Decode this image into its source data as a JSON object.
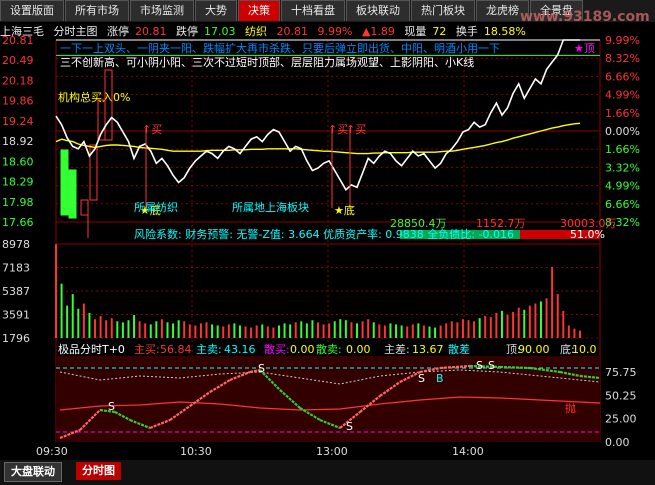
{
  "tabs": [
    "设置版面",
    "所有市场",
    "市场监测",
    "大势",
    "决策",
    "十档看盘",
    "板块联动",
    "热门板块",
    "龙虎榜",
    "全景盘"
  ],
  "active_tab": "决策",
  "watermark": "www.93189.com",
  "info": {
    "name": "上海三毛",
    "mode": "分时主图",
    "zt_label": "涨停",
    "zt": "20.81",
    "dt_label": "跌停",
    "dt": "17.03",
    "sector": "纺织",
    "price": "20.81",
    "pct": "9.99%",
    "chg": "▲1.89",
    "now_label": "现量",
    "now": "72",
    "turn_label": "换手",
    "turn": "18.58%"
  },
  "marquee": [
    "一下一上双头、一阴夹一阳、跌幅扩大再市杀跌、只要后弹立即出货、中阳、明酒小用一下",
    "三不创新高、可小阴小阳、三次不过短时顶部、层层阻力属场观望、上影阴阳、小K线"
  ],
  "labels": {
    "inst": "机构总买入0%",
    "buy1": "买",
    "buy2": "买",
    "buy3": "买",
    "sector1": "所属纺织",
    "sector2": "所属地上海板块",
    "low1": "底",
    "low2": "底",
    "top": "顶",
    "risk": "风险系数: 财务预警: 无警-Z值: 3.664 优质资产率: 0.9838 全负债比: -0.016",
    "pct_bar": "51.0%",
    "flow1": "28850.4万",
    "flow2": "1152.7万",
    "flow3": "30003.0万"
  },
  "price_axis": {
    "left": [
      "20.81",
      "20.49",
      "20.18",
      "19.86",
      "19.24",
      "18.92",
      "18.60",
      "18.29",
      "17.98",
      "17.66"
    ],
    "right": [
      "9.99%",
      "8.32%",
      "6.66%",
      "4.99%",
      "1.66%",
      "0.00%",
      "1.66%",
      "3.32%",
      "4.99%",
      "6.66%",
      "8.32%"
    ]
  },
  "volume_axis": [
    "8978",
    "7183",
    "5387",
    "3591",
    "1796"
  ],
  "indicator": {
    "name": "极品分时T+0",
    "main_buy_label": "主买:",
    "main_buy": "56.84",
    "main_sell_label": "主卖:",
    "main_sell": "43.16",
    "retail_buy_label": "散买:",
    "retail_buy": "0.00",
    "retail_sell_label": "散卖:",
    "retail_sell": "0.00",
    "diff_label": "主差:",
    "diff": "13.67",
    "extra": "散差",
    "top_label": "顶:",
    "top": "90.00",
    "bot_label": "底:",
    "bot": "10.0",
    "axis": [
      "75.75",
      "50.25",
      "25.00",
      "0.00"
    ],
    "marks": {
      "s": "S",
      "b": "B",
      "buy": "买",
      "sell": "抛"
    }
  },
  "time_axis": [
    "09:30",
    "10:30",
    "13:00",
    "14:00"
  ],
  "bottom_tabs": [
    "大盘联动",
    "分时图"
  ],
  "colors": {
    "price": "#ffffff",
    "avg": "#ffff00",
    "up": "#ff3030",
    "down": "#00ff00",
    "grid": "#8b0000",
    "cyan": "#00ffff"
  },
  "chart_data": {
    "type": "line",
    "title": "上海三毛 分时主图",
    "ylim": [
      17.03,
      20.81
    ],
    "price": [
      19.23,
      19.05,
      18.78,
      18.6,
      18.55,
      18.7,
      18.4,
      18.55,
      18.85,
      19.05,
      19.2,
      19.1,
      18.9,
      18.7,
      18.35,
      18.6,
      18.65,
      18.5,
      18.25,
      18.35,
      18.2,
      18.0,
      17.85,
      17.95,
      18.15,
      18.3,
      18.4,
      18.5,
      18.45,
      18.35,
      18.5,
      18.6,
      18.55,
      18.45,
      18.6,
      18.75,
      18.8,
      18.7,
      18.85,
      18.95,
      18.9,
      18.7,
      18.5,
      18.6,
      18.55,
      18.3,
      18.1,
      18.15,
      18.25,
      18.3,
      18.1,
      17.9,
      17.7,
      17.8,
      17.75,
      18.05,
      18.35,
      18.25,
      18.4,
      18.5,
      18.45,
      18.3,
      18.2,
      18.35,
      18.5,
      18.4,
      18.45,
      18.3,
      18.15,
      18.25,
      18.45,
      18.55,
      18.7,
      18.9,
      18.95,
      19.1,
      19.0,
      19.05,
      19.3,
      19.5,
      19.25,
      19.4,
      19.7,
      19.9,
      19.6,
      19.8,
      20.0,
      19.9,
      20.2,
      20.35,
      20.5,
      20.81,
      20.81,
      20.81,
      20.81
    ],
    "avg": [
      18.7,
      18.75,
      18.72,
      18.7,
      18.65,
      18.62,
      18.6,
      18.58,
      18.6,
      18.62,
      18.63,
      18.63,
      18.62,
      18.61,
      18.6,
      18.58,
      18.57,
      18.56,
      18.55,
      18.54,
      18.52,
      18.5,
      18.5,
      18.5,
      18.5,
      18.5,
      18.5,
      18.51,
      18.52,
      18.52,
      18.52,
      18.52,
      18.53,
      18.53,
      18.53,
      18.54,
      18.54,
      18.54,
      18.55,
      18.55,
      18.55,
      18.55,
      18.55,
      18.55,
      18.54,
      18.53,
      18.52,
      18.51,
      18.5,
      18.5,
      18.49,
      18.48,
      18.47,
      18.46,
      18.45,
      18.45,
      18.45,
      18.46,
      18.46,
      18.47,
      18.47,
      18.47,
      18.47,
      18.47,
      18.48,
      18.48,
      18.48,
      18.48,
      18.48,
      18.49,
      18.5,
      18.5,
      18.52,
      18.54,
      18.56,
      18.58,
      18.6,
      18.62,
      18.65,
      18.68,
      18.7,
      18.73,
      18.77,
      18.8,
      18.83,
      18.86,
      18.89,
      18.92,
      18.95,
      18.98,
      19.0,
      19.03,
      19.05,
      19.07,
      19.08
    ],
    "volume": [
      8978,
      5200,
      3100,
      4200,
      2800,
      3300,
      2400,
      1800,
      2100,
      1700,
      1900,
      1600,
      1500,
      1700,
      2200,
      1600,
      1400,
      1300,
      1600,
      1800,
      1500,
      1400,
      1700,
      1600,
      1300,
      1200,
      1400,
      1500,
      1300,
      1200,
      1100,
      1300,
      1400,
      1200,
      1100,
      1000,
      1200,
      1300,
      1100,
      1000,
      1200,
      1400,
      1300,
      1500,
      1600,
      1400,
      1700,
      1500,
      1300,
      1400,
      1600,
      1800,
      1700,
      1500,
      1400,
      1600,
      1800,
      1500,
      1300,
      1200,
      1400,
      1300,
      1200,
      1100,
      1300,
      1400,
      1200,
      1100,
      1000,
      1200,
      1400,
      1600,
      1500,
      1800,
      1700,
      1600,
      1900,
      2100,
      2000,
      2400,
      2600,
      2200,
      2500,
      2900,
      2700,
      3100,
      3300,
      3500,
      3800,
      6800,
      4200,
      2600,
      1200,
      900,
      700
    ]
  }
}
